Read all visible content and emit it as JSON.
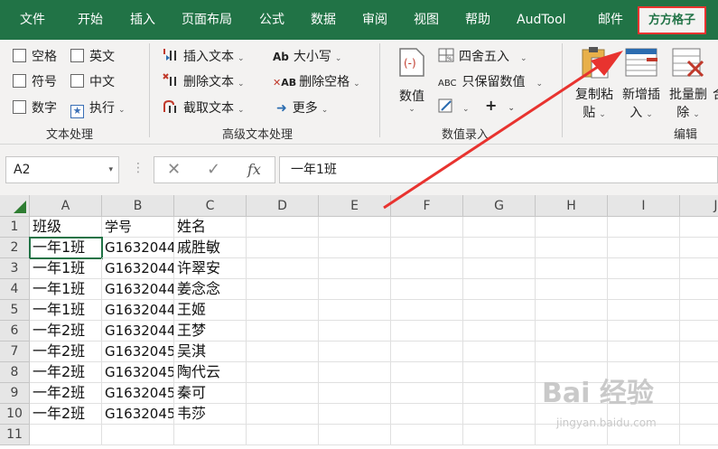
{
  "tabs": [
    {
      "label": "文件"
    },
    {
      "label": "开始"
    },
    {
      "label": "插入"
    },
    {
      "label": "页面布局"
    },
    {
      "label": "公式"
    },
    {
      "label": "数据"
    },
    {
      "label": "审阅"
    },
    {
      "label": "视图"
    },
    {
      "label": "帮助"
    },
    {
      "label": "AudTool"
    },
    {
      "label": "邮件"
    },
    {
      "label": "方方格子",
      "active": true
    }
  ],
  "ribbon": {
    "text_processing": {
      "items": [
        "空格",
        "英文",
        "符号",
        "中文",
        "数字",
        "执行"
      ],
      "label": "文本处理"
    },
    "advanced_text": {
      "insert_text": "插入文本",
      "delete_text": "删除文本",
      "extract_text": "截取文本",
      "case": "大小写",
      "delete_spaces": "删除空格",
      "more": "更多",
      "label": "高级文本处理"
    },
    "numeric_entry": {
      "value_btn": "数值",
      "round": "四舍五入",
      "keep_value": "只保留数值",
      "plus": "+",
      "label": "数值录入"
    },
    "edit": {
      "copy_paste_1": "复制粘",
      "copy_paste_2": "贴",
      "add_insert_1": "新增插",
      "add_insert_2": "入",
      "batch_delete_1": "批量删",
      "batch_delete_2": "除",
      "cut_partial": "合",
      "label": "编辑"
    }
  },
  "formula_bar": {
    "name_box": "A2",
    "formula": "一年1班"
  },
  "sheet": {
    "columns": [
      "A",
      "B",
      "C",
      "D",
      "E",
      "F",
      "G",
      "H",
      "I",
      "J"
    ],
    "rows": [
      [
        "班级",
        "学号",
        "姓名"
      ],
      [
        "一年1班",
        "G1632044",
        "戚胜敏"
      ],
      [
        "一年1班",
        "G1632044",
        "许翠安"
      ],
      [
        "一年1班",
        "G1632044",
        "姜念念"
      ],
      [
        "一年1班",
        "G1632044",
        "王姬"
      ],
      [
        "一年2班",
        "G1632044",
        "王梦"
      ],
      [
        "一年2班",
        "G1632045",
        "吴淇"
      ],
      [
        "一年2班",
        "G1632045",
        "陶代云"
      ],
      [
        "一年2班",
        "G1632045",
        "秦可"
      ],
      [
        "一年2班",
        "G1632045",
        "韦莎"
      ],
      [
        "",
        "",
        ""
      ]
    ],
    "row_numbers": [
      "1",
      "2",
      "3",
      "4",
      "5",
      "6",
      "7",
      "8",
      "9",
      "10",
      "11"
    ]
  },
  "watermark": {
    "main": "Bai 经验",
    "sub": "jingyan.baidu.com"
  },
  "colors": {
    "excel_green": "#217346",
    "highlight_red": "#e8332f"
  }
}
